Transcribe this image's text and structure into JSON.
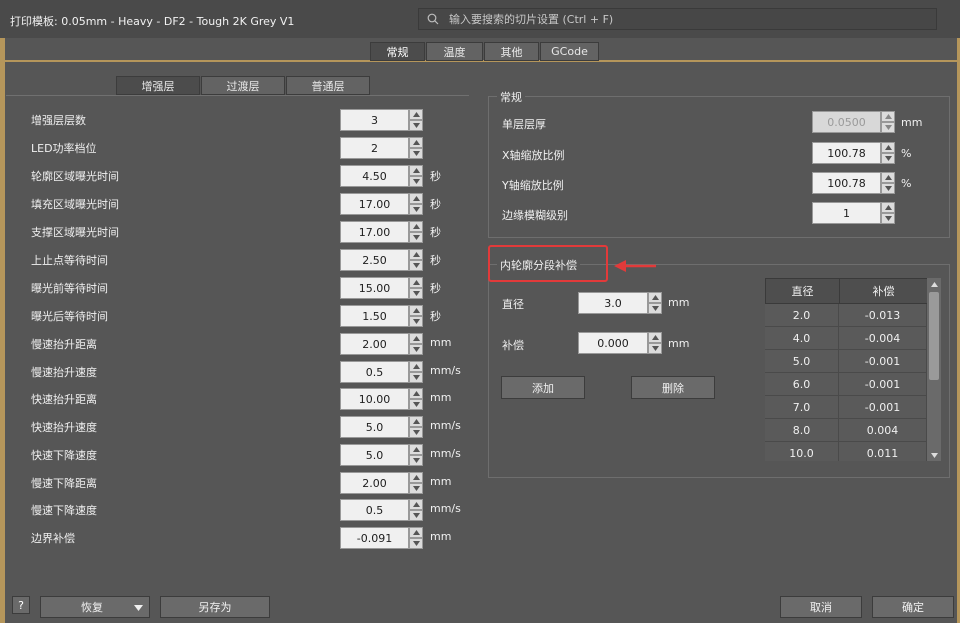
{
  "window": {
    "title": "打印模板: 0.05mm - Heavy - DF2 - Tough 2K Grey V1",
    "search_placeholder": "输入要搜索的切片设置 (Ctrl + F)"
  },
  "top_tabs": [
    {
      "label": "常规",
      "active": true
    },
    {
      "label": "温度",
      "active": false
    },
    {
      "label": "其他",
      "active": false
    },
    {
      "label": "GCode",
      "active": false
    }
  ],
  "sub_tabs": [
    {
      "label": "增强层",
      "active": true
    },
    {
      "label": "过渡层",
      "active": false
    },
    {
      "label": "普通层",
      "active": false
    }
  ],
  "left_settings": [
    {
      "label": "增强层层数",
      "value": "3",
      "unit": ""
    },
    {
      "label": "LED功率档位",
      "value": "2",
      "unit": ""
    },
    {
      "label": "轮廓区域曝光时间",
      "value": "4.50",
      "unit": "秒"
    },
    {
      "label": "填充区域曝光时间",
      "value": "17.00",
      "unit": "秒"
    },
    {
      "label": "支撑区域曝光时间",
      "value": "17.00",
      "unit": "秒"
    },
    {
      "label": "上止点等待时间",
      "value": "2.50",
      "unit": "秒"
    },
    {
      "label": "曝光前等待时间",
      "value": "15.00",
      "unit": "秒"
    },
    {
      "label": "曝光后等待时间",
      "value": "1.50",
      "unit": "秒"
    },
    {
      "label": "慢速抬升距离",
      "value": "2.00",
      "unit": "mm"
    },
    {
      "label": "慢速抬升速度",
      "value": "0.5",
      "unit": "mm/s"
    },
    {
      "label": "快速抬升距离",
      "value": "10.00",
      "unit": "mm"
    },
    {
      "label": "快速抬升速度",
      "value": "5.0",
      "unit": "mm/s"
    },
    {
      "label": "快速下降速度",
      "value": "5.0",
      "unit": "mm/s"
    },
    {
      "label": "慢速下降距离",
      "value": "2.00",
      "unit": "mm"
    },
    {
      "label": "慢速下降速度",
      "value": "0.5",
      "unit": "mm/s"
    },
    {
      "label": "边界补偿",
      "value": "-0.091",
      "unit": "mm"
    }
  ],
  "general_group": {
    "title": "常规",
    "rows": [
      {
        "label": "单层层厚",
        "value": "0.0500",
        "unit": "mm",
        "disabled": true
      },
      {
        "label": "X轴缩放比例",
        "value": "100.78",
        "unit": "%",
        "disabled": false
      },
      {
        "label": "Y轴缩放比例",
        "value": "100.78",
        "unit": "%",
        "disabled": false
      },
      {
        "label": "边缘模糊级别",
        "value": "1",
        "unit": "",
        "disabled": false
      }
    ]
  },
  "contour_group": {
    "title": "内轮廓分段补偿",
    "diameter_label": "直径",
    "diameter_value": "3.0",
    "diameter_unit": "mm",
    "comp_label": "补偿",
    "comp_value": "0.000",
    "comp_unit": "mm",
    "add_label": "添加",
    "delete_label": "删除",
    "table_headers": [
      "直径",
      "补偿"
    ],
    "table_rows": [
      [
        "2.0",
        "-0.013"
      ],
      [
        "4.0",
        "-0.004"
      ],
      [
        "5.0",
        "-0.001"
      ],
      [
        "6.0",
        "-0.001"
      ],
      [
        "7.0",
        "-0.001"
      ],
      [
        "8.0",
        "0.004"
      ],
      [
        "10.0",
        "0.011"
      ]
    ]
  },
  "bottom_bar": {
    "help_label": "?",
    "restore_label": "恢复",
    "save_as_label": "另存为",
    "cancel_label": "取消",
    "ok_label": "确定"
  },
  "colors": {
    "accent": "#b5965b",
    "highlight": "#e23a3a",
    "background": "#565656"
  }
}
